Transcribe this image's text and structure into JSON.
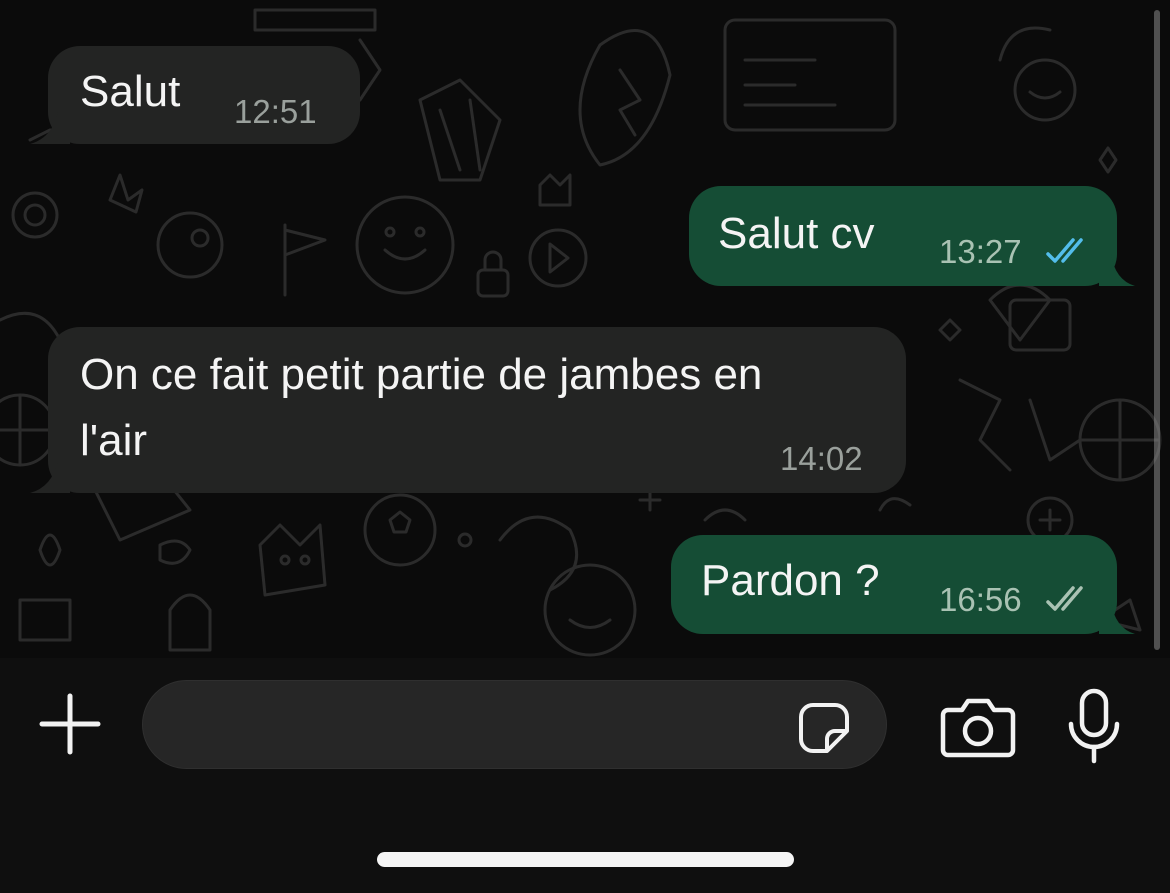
{
  "colors": {
    "chat_background": "#0b0b0b",
    "incoming_bubble": "#232423",
    "outgoing_bubble": "#154d35",
    "read_ticks": "#53bdeb",
    "delivered_ticks": "#a9c2b3",
    "composer_background": "#0f0f0f",
    "input_background": "#262626"
  },
  "messages": [
    {
      "direction": "incoming",
      "text": "Salut",
      "time": "12:51"
    },
    {
      "direction": "outgoing",
      "text": "Salut cv",
      "time": "13:27",
      "status": "read"
    },
    {
      "direction": "incoming",
      "text_lines": [
        "On ce fait petit partie de jambes en",
        "l'air"
      ],
      "time": "14:02"
    },
    {
      "direction": "outgoing",
      "text": "Pardon ?",
      "time": "16:56",
      "status": "delivered"
    }
  ],
  "composer": {
    "input_value": "",
    "icons": {
      "add": "plus-icon",
      "sticker": "sticker-icon",
      "camera": "camera-icon",
      "microphone": "microphone-icon"
    }
  }
}
